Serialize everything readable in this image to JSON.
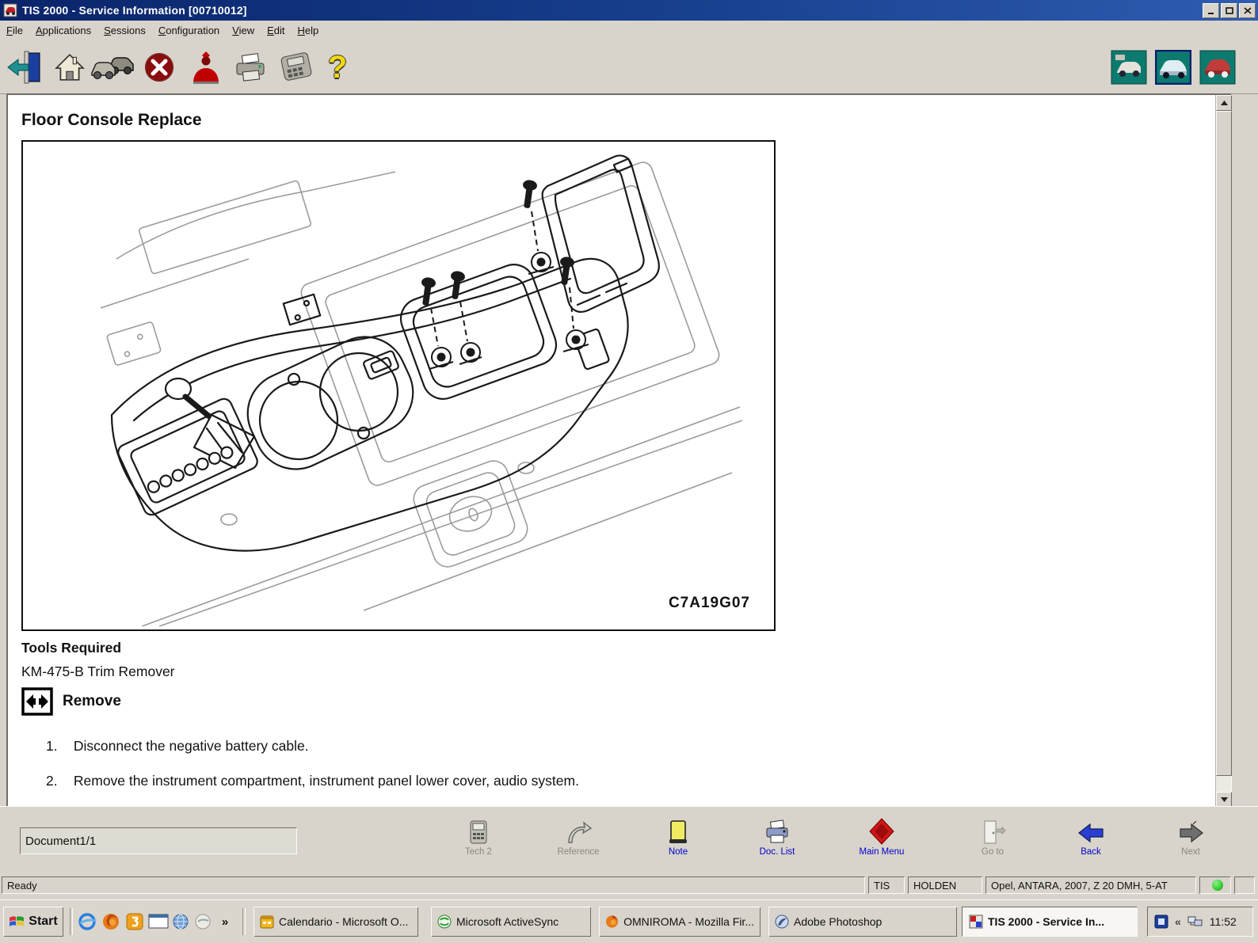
{
  "window": {
    "title": "TIS 2000 - Service Information [00710012]"
  },
  "menu": {
    "items": [
      "File",
      "Applications",
      "Sessions",
      "Configuration",
      "View",
      "Edit",
      "Help"
    ]
  },
  "toolbar": {
    "left_icons": [
      "exit",
      "home",
      "vehicles",
      "stop",
      "user",
      "print",
      "tech2-device",
      "help"
    ],
    "right_buttons": [
      "vehicle-graphic-1",
      "vehicle-graphic-2",
      "vehicle-graphic-3"
    ]
  },
  "document": {
    "heading": "Floor Console Replace",
    "figure_code": "C7A19G07",
    "tools_required_label": "Tools Required",
    "tools_required_value": "KM-475-B Trim Remover",
    "remove_heading": "Remove",
    "steps": [
      {
        "num": "1.",
        "text": "Disconnect the negative battery cable."
      },
      {
        "num": "2.",
        "text": "Remove the instrument compartment, instrument panel lower cover, audio system."
      }
    ]
  },
  "bottom_toolbar": {
    "document_field": "Document1/1",
    "buttons": [
      {
        "label": "Tech 2",
        "icon": "tech2-device",
        "enabled": false
      },
      {
        "label": "Reference",
        "icon": "reference-arrow",
        "enabled": false
      },
      {
        "label": "Note",
        "icon": "yellow-note",
        "enabled": true
      },
      {
        "label": "Doc. List",
        "icon": "printer",
        "enabled": true
      },
      {
        "label": "Main Menu",
        "icon": "red-diamond",
        "enabled": true
      },
      {
        "label": "Go to",
        "icon": "door",
        "enabled": false
      },
      {
        "label": "Back",
        "icon": "blue-left-arrow",
        "enabled": true
      },
      {
        "label": "Next",
        "icon": "gray-right-arrow",
        "enabled": false
      }
    ]
  },
  "status_bar": {
    "message": "Ready",
    "app": "TIS",
    "dealer": "HOLDEN",
    "vehicle": "Opel, ANTARA, 2007, Z 20 DMH, 5-AT"
  },
  "taskbar": {
    "start_label": "Start",
    "quick_launch": [
      "internet-explorer",
      "firefox",
      "orange-app",
      "show-desktop",
      "globe",
      "browser"
    ],
    "overflow_chevron": "»",
    "tasks": [
      {
        "label": "Calendario - Microsoft O...",
        "active": false
      },
      {
        "label": "Microsoft ActiveSync",
        "active": false
      },
      {
        "label": "OMNIROMA - Mozilla Fir...",
        "active": false
      },
      {
        "label": "Adobe Photoshop",
        "active": false
      },
      {
        "label": "TIS 2000 - Service In...",
        "active": true
      }
    ],
    "tray_chevron": "«",
    "clock": "11:52"
  },
  "colors": {
    "title_gradient_start": "#0a246a",
    "title_gradient_end": "#2f5cb0",
    "chrome": "#d8d4cb",
    "enabled_label_blue": "#0000cc",
    "disabled_label_gray": "#8a877e",
    "note_yellow": "#f0ec62",
    "main_menu_red": "#d11616",
    "status_green": "#33cc33",
    "teal_button": "#0d7a6f"
  }
}
